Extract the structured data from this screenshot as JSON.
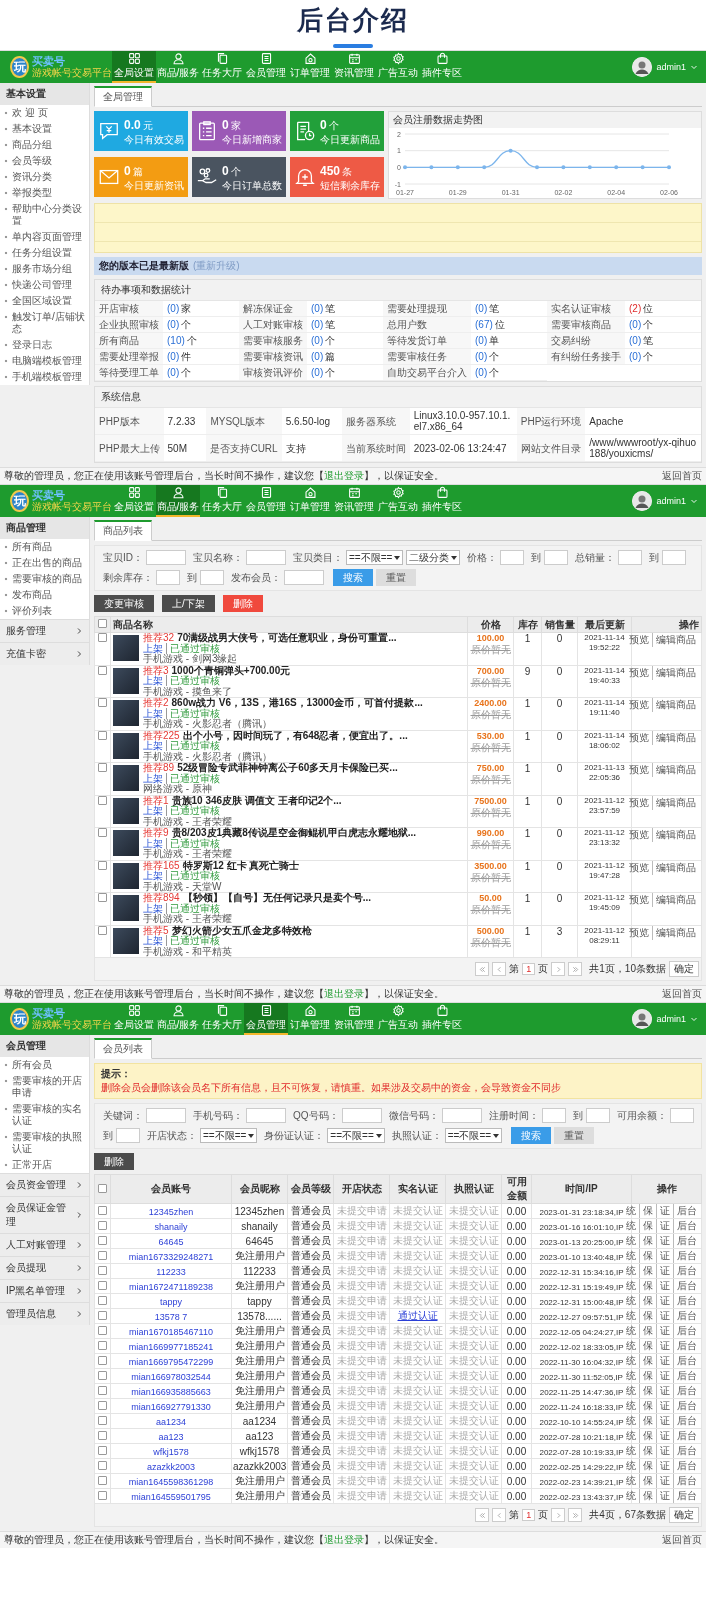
{
  "title": "后台介绍",
  "panels": [
    {
      "kind": "overview",
      "header": {
        "logo": {
          "mark": "玩",
          "name": "买卖号",
          "tagline": "游戏帐号交易平台"
        },
        "nav": [
          {
            "label": "全局设置",
            "selected": true
          },
          {
            "label": "商品/服务",
            "selected": false
          },
          {
            "label": "任务大厅",
            "selected": false
          },
          {
            "label": "会员管理",
            "selected": false
          },
          {
            "label": "订单管理",
            "selected": false
          },
          {
            "label": "资讯管理",
            "selected": false
          },
          {
            "label": "广告互动",
            "selected": false
          },
          {
            "label": "插件专区",
            "selected": false
          }
        ],
        "user": "admin1"
      },
      "sidebar": {
        "title": "基本设置",
        "items": [
          "欢 迎 页",
          "基本设置",
          "商品分组",
          "会员等级",
          "资讯分类",
          "举报类型",
          "帮助中心分类设置",
          "单内容页面管理",
          "任务分组设置",
          "服务市场分组",
          "快递公司管理",
          "全国区域设置",
          "触发订单/店铺状态",
          "登录日志",
          "电脑端模板管理",
          "手机端模板管理"
        ]
      },
      "tabs": [
        {
          "label": "全局管理",
          "selected": true
        }
      ],
      "overview": {
        "cards": [
          {
            "value": "0.0",
            "unit": "元",
            "label": "今日有效交易",
            "color": "#1fa9e1"
          },
          {
            "value": "0",
            "unit": "家",
            "label": "今日新增商家",
            "color": "#9b59b6"
          },
          {
            "value": "0",
            "unit": "个",
            "label": "今日更新商品",
            "color": "#22a03a"
          },
          {
            "value": "0",
            "unit": "篇",
            "label": "今日更新资讯",
            "color": "#f39c12"
          },
          {
            "value": "0",
            "unit": "个",
            "label": "今日订单总数",
            "color": "#4a5460"
          },
          {
            "value": "450",
            "unit": "条",
            "label": "短信剩余库存",
            "color": "#ee5a45"
          }
        ],
        "chart_data": {
          "type": "line",
          "title": "会员注册数据走势图",
          "categories": [
            "01-27",
            null,
            "01-29",
            null,
            "01-31",
            null,
            "02-02",
            null,
            "02-04",
            null,
            "02-06"
          ],
          "series": [
            {
              "color": "#7cb5ec",
              "values": [
                0,
                0,
                0,
                0,
                1,
                0,
                0,
                0,
                0,
                0,
                0
              ]
            }
          ],
          "ylim": [
            -1,
            2
          ],
          "yticks": [
            -1,
            0,
            1,
            2
          ]
        },
        "version": {
          "status": "您的版本已是最新版",
          "link": "(重新升级)"
        },
        "todo": {
          "title": "待办事项和数据统计",
          "items": [
            {
              "label": "开店审核",
              "count": "(0)",
              "unit": "家",
              "alert": false
            },
            {
              "label": "解冻保证金",
              "count": "(0)",
              "unit": "笔",
              "alert": false
            },
            {
              "label": "需要处理提现",
              "count": "(0)",
              "unit": "笔",
              "alert": false
            },
            {
              "label": "实名认证审核",
              "count": "(2)",
              "unit": "位",
              "alert": true
            },
            {
              "label": "企业执照审核",
              "count": "(0)",
              "unit": "个",
              "alert": false
            },
            {
              "label": "人工对账审核",
              "count": "(0)",
              "unit": "笔",
              "alert": false
            },
            {
              "label": "总用户数",
              "count": "(67)",
              "unit": "位",
              "alert": false
            },
            {
              "label": "需要审核商品",
              "count": "(0)",
              "unit": "个",
              "alert": false
            },
            {
              "label": "所有商品",
              "count": "(10)",
              "unit": "个",
              "alert": false
            },
            {
              "label": "需要审核服务",
              "count": "(0)",
              "unit": "个",
              "alert": false
            },
            {
              "label": "等待发货订单",
              "count": "(0)",
              "unit": "单",
              "alert": false
            },
            {
              "label": "交易纠纷",
              "count": "(0)",
              "unit": "笔",
              "alert": false
            },
            {
              "label": "需要处理举报",
              "count": "(0)",
              "unit": "件",
              "alert": false
            },
            {
              "label": "需要审核资讯",
              "count": "(0)",
              "unit": "篇",
              "alert": false
            },
            {
              "label": "需要审核任务",
              "count": "(0)",
              "unit": "个",
              "alert": false
            },
            {
              "label": "有纠纷任务接手",
              "count": "(0)",
              "unit": "个",
              "alert": false
            },
            {
              "label": "等待受理工单",
              "count": "(0)",
              "unit": "个",
              "alert": false
            },
            {
              "label": "审核资讯评价",
              "count": "(0)",
              "unit": "个",
              "alert": false
            },
            {
              "label": "自助交易平台介入",
              "count": "(0)",
              "unit": "个",
              "alert": false
            }
          ]
        },
        "sysinfo": {
          "title": "系统信息",
          "items": [
            {
              "label": "PHP版本",
              "value": "7.2.33"
            },
            {
              "label": "MYSQL版本",
              "value": "5.6.50-log"
            },
            {
              "label": "服务器系统",
              "value": "Linux3.10.0-957.10.1.el7.x86_64"
            },
            {
              "label": "PHP运行环境",
              "value": "Apache"
            },
            {
              "label": "PHP最大上传",
              "value": "50M"
            },
            {
              "label": "是否支持CURL",
              "value": "支持"
            },
            {
              "label": "当前系统时间",
              "value": "2023-02-06 13:24:47"
            },
            {
              "label": "网站文件目录",
              "value": "/www/wwwroot/yx-qihuo188/youxicms/"
            }
          ]
        }
      },
      "footer": {
        "before": "尊敬的管理员，您正在使用该账号管理后台，当长时间不操作，建议您【",
        "link": "退出登录",
        "after": "】，以保证安全。",
        "home": "返回首页"
      }
    },
    {
      "kind": "products",
      "header": {
        "logo": {
          "mark": "玩",
          "name": "买卖号",
          "tagline": "游戏帐号交易平台"
        },
        "nav": [
          {
            "label": "全局设置",
            "selected": false
          },
          {
            "label": "商品/服务",
            "selected": true
          },
          {
            "label": "任务大厅",
            "selected": false
          },
          {
            "label": "会员管理",
            "selected": false
          },
          {
            "label": "订单管理",
            "selected": false
          },
          {
            "label": "资讯管理",
            "selected": false
          },
          {
            "label": "广告互动",
            "selected": false
          },
          {
            "label": "插件专区",
            "selected": false
          }
        ],
        "user": "admin1"
      },
      "sidebar": {
        "title": "商品管理",
        "items": [
          "所有商品",
          "正在出售的商品",
          "需要审核的商品",
          "发布商品",
          "评价列表"
        ],
        "groups": [
          "服务管理",
          "充值卡密"
        ]
      },
      "tabs": [
        {
          "label": "商品列表",
          "selected": true
        }
      ],
      "filters": {
        "fields": [
          {
            "kind": "input",
            "label": "宝贝ID："
          },
          {
            "kind": "input",
            "label": "宝贝名称："
          },
          {
            "kind": "select",
            "label": "宝贝类目：",
            "value": "==不限=="
          },
          {
            "kind": "select",
            "value": "二级分类"
          },
          {
            "kind": "range",
            "label": "价格：",
            "sep": "到"
          },
          {
            "kind": "range",
            "label": "总销量：",
            "sep": "到"
          },
          {
            "kind": "range",
            "label": "剩余库存：",
            "sep": "到"
          },
          {
            "kind": "input",
            "label": "发布会员："
          }
        ],
        "search": "搜索",
        "reset": "重置"
      },
      "actions": [
        {
          "label": "变更审核",
          "kind": "dark"
        },
        {
          "label": "上/下架",
          "kind": "dark"
        },
        {
          "label": "删除",
          "kind": "danger"
        }
      ],
      "table": {
        "all_checked": false,
        "columns": [
          "商品名称",
          "价格",
          "库存",
          "销售量",
          "最后更新",
          "操作"
        ],
        "rows": [
          {
            "checked": false,
            "tag": "推荐32",
            "title": "70满级战男大侠号，可选任意职业，身份可重置...",
            "status": "上架",
            "review": "已通过审核",
            "category": "手机游戏 - 剑网3缘起",
            "price": "100.00",
            "original": "原价暂无",
            "stock": "1",
            "sold": "0",
            "date": "2021-11-14",
            "time": "19:52:22",
            "ops": [
              "预览",
              "编辑商品"
            ]
          },
          {
            "checked": false,
            "tag": "推荐3",
            "title": "1000个青铜弹头+700.00元",
            "status": "上架",
            "review": "已通过审核",
            "category": "手机游戏 - 摸鱼来了",
            "price": "700.00",
            "original": "原价暂无",
            "stock": "9",
            "sold": "0",
            "date": "2021-11-14",
            "time": "19:40:33",
            "ops": [
              "预览",
              "编辑商品"
            ]
          },
          {
            "checked": false,
            "tag": "推荐2",
            "title": "860w战力 V6，13S，港16S，13000金币，可首付提款...",
            "status": "上架",
            "review": "已通过审核",
            "category": "手机游戏 - 火影忍者（腾讯）",
            "price": "2400.00",
            "original": "原价暂无",
            "stock": "1",
            "sold": "0",
            "date": "2021-11-14",
            "time": "19:11:40",
            "ops": [
              "预览",
              "编辑商品"
            ]
          },
          {
            "checked": false,
            "tag": "推荐225",
            "title": "出个小号，因时间玩了，有648忍者，便宜出了。...",
            "status": "上架",
            "review": "已通过审核",
            "category": "手机游戏 - 火影忍者（腾讯）",
            "price": "530.00",
            "original": "原价暂无",
            "stock": "1",
            "sold": "0",
            "date": "2021-11-14",
            "time": "18:06:02",
            "ops": [
              "预览",
              "编辑商品"
            ]
          },
          {
            "checked": false,
            "tag": "推荐89",
            "title": "52级冒险专武菲神钟离公子60多天月卡保险已买...",
            "status": "上架",
            "review": "已通过审核",
            "category": "网络游戏 - 原神",
            "price": "750.00",
            "original": "原价暂无",
            "stock": "1",
            "sold": "0",
            "date": "2021-11-13",
            "time": "22:05:36",
            "ops": [
              "预览",
              "编辑商品"
            ]
          },
          {
            "checked": false,
            "tag": "推荐1",
            "title": "贵族10 346皮肤 调值文 王者印记2个...",
            "status": "上架",
            "review": "已通过审核",
            "category": "手机游戏 - 王者荣耀",
            "price": "7500.00",
            "original": "原价暂无",
            "stock": "1",
            "sold": "0",
            "date": "2021-11-12",
            "time": "23:57:59",
            "ops": [
              "预览",
              "编辑商品"
            ]
          },
          {
            "checked": false,
            "tag": "推荐9",
            "title": "贵8/203皮1典藏8传说星空金御鲲机甲白虎志永耀地狱...",
            "status": "上架",
            "review": "已通过审核",
            "category": "手机游戏 - 王者荣耀",
            "price": "990.00",
            "original": "原价暂无",
            "stock": "1",
            "sold": "0",
            "date": "2021-11-12",
            "time": "23:13:32",
            "ops": [
              "预览",
              "编辑商品"
            ]
          },
          {
            "checked": false,
            "tag": "推荐165",
            "title": "特罗斯12 红卡 真死亡骑士",
            "status": "上架",
            "review": "已通过审核",
            "category": "手机游戏 - 天堂W",
            "price": "3500.00",
            "original": "原价暂无",
            "stock": "1",
            "sold": "0",
            "date": "2021-11-12",
            "time": "19:47:28",
            "ops": [
              "预览",
              "编辑商品"
            ]
          },
          {
            "checked": false,
            "tag": "推荐894",
            "title": "【秒领】【自号】无任何记录只是卖个号...",
            "status": "上架",
            "review": "已通过审核",
            "category": "手机游戏 - 王者荣耀",
            "price": "50.00",
            "original": "原价暂无",
            "stock": "1",
            "sold": "0",
            "date": "2021-11-12",
            "time": "19:45:09",
            "ops": [
              "预览",
              "编辑商品"
            ]
          },
          {
            "checked": false,
            "tag": "推荐5",
            "title": "梦幻火箭少女五爪金龙多特效枪",
            "status": "上架",
            "review": "已通过审核",
            "category": "手机游戏 - 和平精英",
            "price": "500.00",
            "original": "原价暂无",
            "stock": "1",
            "sold": "3",
            "date": "2021-11-12",
            "time": "08:29:11",
            "ops": [
              "预览",
              "编辑商品"
            ]
          }
        ]
      },
      "pager": {
        "before": "第",
        "page": "1",
        "after": "页",
        "info": "共1页，10条数据",
        "confirm": "确定"
      },
      "footer": {
        "before": "尊敬的管理员，您正在使用该账号管理后台，当长时间不操作，建议您【",
        "link": "退出登录",
        "after": "】，以保证安全。",
        "home": "返回首页"
      }
    },
    {
      "kind": "members",
      "header": {
        "logo": {
          "mark": "玩",
          "name": "买卖号",
          "tagline": "游戏帐号交易平台"
        },
        "nav": [
          {
            "label": "全局设置",
            "selected": false
          },
          {
            "label": "商品/服务",
            "selected": false
          },
          {
            "label": "任务大厅",
            "selected": false
          },
          {
            "label": "会员管理",
            "selected": true
          },
          {
            "label": "订单管理",
            "selected": false
          },
          {
            "label": "资讯管理",
            "selected": false
          },
          {
            "label": "广告互动",
            "selected": false
          },
          {
            "label": "插件专区",
            "selected": false
          }
        ],
        "user": "admin1"
      },
      "sidebar": {
        "title": "会员管理",
        "items": [
          "所有会员",
          "需要审核的开店申请",
          "需要审核的实名认证",
          "需要审核的执照认证",
          "正常开店"
        ],
        "groups": [
          "会员资金管理",
          "会员保证金管理",
          "人工对账管理",
          "会员提现",
          "IP黑名单管理",
          "管理员信息"
        ]
      },
      "tabs": [
        {
          "label": "会员列表",
          "selected": true
        }
      ],
      "notice": {
        "title": "提示：",
        "text": "删除会员会删除该会员名下所有信息，且不可恢复，请慎重。如果涉及交易中的资金，会导致资金不同步"
      },
      "filters": {
        "fields": [
          {
            "kind": "input",
            "label": "关键词："
          },
          {
            "kind": "input",
            "label": "手机号码："
          },
          {
            "kind": "input",
            "label": "QQ号码："
          },
          {
            "kind": "input",
            "label": "微信号码："
          },
          {
            "kind": "range",
            "label": "注册时间：",
            "sep": "到"
          },
          {
            "kind": "range",
            "label": "可用余额：",
            "sep": "到"
          },
          {
            "kind": "select",
            "label": "开店状态：",
            "value": "==不限=="
          },
          {
            "kind": "select",
            "label": "身份证认证：",
            "value": "==不限=="
          },
          {
            "kind": "select",
            "label": "执照认证：",
            "value": "==不限=="
          }
        ],
        "search": "搜索",
        "reset": "重置"
      },
      "actions": [
        {
          "label": "删除",
          "kind": "dark"
        }
      ],
      "table": {
        "all_checked": false,
        "columns": [
          "会员账号",
          "会员昵称",
          "会员等级",
          "开店状态",
          "实名认证",
          "执照认证",
          "可用金额",
          "时间/IP",
          "操作"
        ],
        "rows": [
          {
            "checked": false,
            "account": "12345zhen",
            "nickname": "12345zhen",
            "level": "普通会员",
            "shop": "未提交申请",
            "realname": "未提交认证",
            "verified": false,
            "license": "未提交认证",
            "balance": "0.00",
            "time": "2023-01-31 23:18:34,IP",
            "ops": [
              "统",
              "保",
              "证",
              "后台"
            ]
          },
          {
            "checked": false,
            "account": "shanaily",
            "nickname": "shanaily",
            "level": "普通会员",
            "shop": "未提交申请",
            "realname": "未提交认证",
            "verified": false,
            "license": "未提交认证",
            "balance": "0.00",
            "time": "2023-01-16 16:01:10,IP",
            "ops": [
              "统",
              "保",
              "证",
              "后台"
            ]
          },
          {
            "checked": false,
            "account": "64645",
            "nickname": "64645",
            "level": "普通会员",
            "shop": "未提交申请",
            "realname": "未提交认证",
            "verified": false,
            "license": "未提交认证",
            "balance": "0.00",
            "time": "2023-01-13 20:25:00,IP",
            "ops": [
              "统",
              "保",
              "证",
              "后台"
            ]
          },
          {
            "checked": false,
            "account": "mian1673329248271",
            "nickname": "免注册用户",
            "level": "普通会员",
            "shop": "未提交申请",
            "realname": "未提交认证",
            "verified": false,
            "license": "未提交认证",
            "balance": "0.00",
            "time": "2023-01-10 13:40:48,IP",
            "ops": [
              "统",
              "保",
              "证",
              "后台"
            ]
          },
          {
            "checked": false,
            "account": "112233",
            "nickname": "112233",
            "level": "普通会员",
            "shop": "未提交申请",
            "realname": "未提交认证",
            "verified": false,
            "license": "未提交认证",
            "balance": "0.00",
            "time": "2022-12-31 15:34:16,IP",
            "ops": [
              "统",
              "保",
              "证",
              "后台"
            ]
          },
          {
            "checked": false,
            "account": "mian1672471189238",
            "nickname": "免注册用户",
            "level": "普通会员",
            "shop": "未提交申请",
            "realname": "未提交认证",
            "verified": false,
            "license": "未提交认证",
            "balance": "0.00",
            "time": "2022-12-31 15:19:49,IP",
            "ops": [
              "统",
              "保",
              "证",
              "后台"
            ]
          },
          {
            "checked": false,
            "account": "tappy",
            "nickname": "tappy",
            "level": "普通会员",
            "shop": "未提交申请",
            "realname": "未提交认证",
            "verified": false,
            "license": "未提交认证",
            "balance": "0.00",
            "time": "2022-12-31 15:00:48,IP",
            "ops": [
              "统",
              "保",
              "证",
              "后台"
            ]
          },
          {
            "checked": false,
            "account": "13578 7",
            "nickname": "13578......",
            "level": "普通会员",
            "shop": "未提交申请",
            "realname": "通过认证",
            "verified": true,
            "license": "未提交认证",
            "balance": "0.00",
            "time": "2022-12-27 09:57:51,IP",
            "ops": [
              "统",
              "保",
              "证",
              "后台"
            ]
          },
          {
            "checked": false,
            "account": "mian1670185467110",
            "nickname": "免注册用户",
            "level": "普通会员",
            "shop": "未提交申请",
            "realname": "未提交认证",
            "verified": false,
            "license": "未提交认证",
            "balance": "0.00",
            "time": "2022-12-05 04:24:27,IP",
            "ops": [
              "统",
              "保",
              "证",
              "后台"
            ]
          },
          {
            "checked": false,
            "account": "mian1669977185241",
            "nickname": "免注册用户",
            "level": "普通会员",
            "shop": "未提交申请",
            "realname": "未提交认证",
            "verified": false,
            "license": "未提交认证",
            "balance": "0.00",
            "time": "2022-12-02 18:33:05,IP",
            "ops": [
              "统",
              "保",
              "证",
              "后台"
            ]
          },
          {
            "checked": false,
            "account": "mian1669795472299",
            "nickname": "免注册用户",
            "level": "普通会员",
            "shop": "未提交申请",
            "realname": "未提交认证",
            "verified": false,
            "license": "未提交认证",
            "balance": "0.00",
            "time": "2022-11-30 16:04:32,IP",
            "ops": [
              "统",
              "保",
              "证",
              "后台"
            ]
          },
          {
            "checked": false,
            "account": "mian166978032544",
            "nickname": "免注册用户",
            "level": "普通会员",
            "shop": "未提交申请",
            "realname": "未提交认证",
            "verified": false,
            "license": "未提交认证",
            "balance": "0.00",
            "time": "2022-11-30 11:52:05,IP",
            "ops": [
              "统",
              "保",
              "证",
              "后台"
            ]
          },
          {
            "checked": false,
            "account": "mian166935885663",
            "nickname": "免注册用户",
            "level": "普通会员",
            "shop": "未提交申请",
            "realname": "未提交认证",
            "verified": false,
            "license": "未提交认证",
            "balance": "0.00",
            "time": "2022-11-25 14:47:36,IP",
            "ops": [
              "统",
              "保",
              "证",
              "后台"
            ]
          },
          {
            "checked": false,
            "account": "mian166927791330",
            "nickname": "免注册用户",
            "level": "普通会员",
            "shop": "未提交申请",
            "realname": "未提交认证",
            "verified": false,
            "license": "未提交认证",
            "balance": "0.00",
            "time": "2022-11-24 16:18:33,IP",
            "ops": [
              "统",
              "保",
              "证",
              "后台"
            ]
          },
          {
            "checked": false,
            "account": "aa1234",
            "nickname": "aa1234",
            "level": "普通会员",
            "shop": "未提交申请",
            "realname": "未提交认证",
            "verified": false,
            "license": "未提交认证",
            "balance": "0.00",
            "time": "2022-10-10 14:55:24,IP",
            "ops": [
              "统",
              "保",
              "证",
              "后台"
            ]
          },
          {
            "checked": false,
            "account": "aa123",
            "nickname": "aa123",
            "level": "普通会员",
            "shop": "未提交申请",
            "realname": "未提交认证",
            "verified": false,
            "license": "未提交认证",
            "balance": "0.00",
            "time": "2022-07-28 10:21:18,IP",
            "ops": [
              "统",
              "保",
              "证",
              "后台"
            ]
          },
          {
            "checked": false,
            "account": "wfkj1578",
            "nickname": "wfkj1578",
            "level": "普通会员",
            "shop": "未提交申请",
            "realname": "未提交认证",
            "verified": false,
            "license": "未提交认证",
            "balance": "0.00",
            "time": "2022-07-28 10:19:33,IP",
            "ops": [
              "统",
              "保",
              "证",
              "后台"
            ]
          },
          {
            "checked": false,
            "account": "azazkk2003",
            "nickname": "azazkk2003",
            "level": "普通会员",
            "shop": "未提交申请",
            "realname": "未提交认证",
            "verified": false,
            "license": "未提交认证",
            "balance": "0.00",
            "time": "2022-02-25 14:29:22,IP",
            "ops": [
              "统",
              "保",
              "证",
              "后台"
            ]
          },
          {
            "checked": false,
            "account": "mian1645598361298",
            "nickname": "免注册用户",
            "level": "普通会员",
            "shop": "未提交申请",
            "realname": "未提交认证",
            "verified": false,
            "license": "未提交认证",
            "balance": "0.00",
            "time": "2022-02-23 14:39:21,IP",
            "ops": [
              "统",
              "保",
              "证",
              "后台"
            ]
          },
          {
            "checked": false,
            "account": "mian164559501795",
            "nickname": "免注册用户",
            "level": "普通会员",
            "shop": "未提交申请",
            "realname": "未提交认证",
            "verified": false,
            "license": "未提交认证",
            "balance": "0.00",
            "time": "2022-02-23 13:43:37,IP",
            "ops": [
              "统",
              "保",
              "证",
              "后台"
            ]
          }
        ]
      },
      "pager": {
        "before": "第",
        "page": "1",
        "after": "页",
        "info": "共4页，67条数据",
        "confirm": "确定"
      },
      "footer": {
        "before": "尊敬的管理员，您正在使用该账号管理后台，当长时间不操作，建议您【",
        "link": "退出登录",
        "after": "】，以保证安全。",
        "home": "返回首页"
      }
    }
  ]
}
